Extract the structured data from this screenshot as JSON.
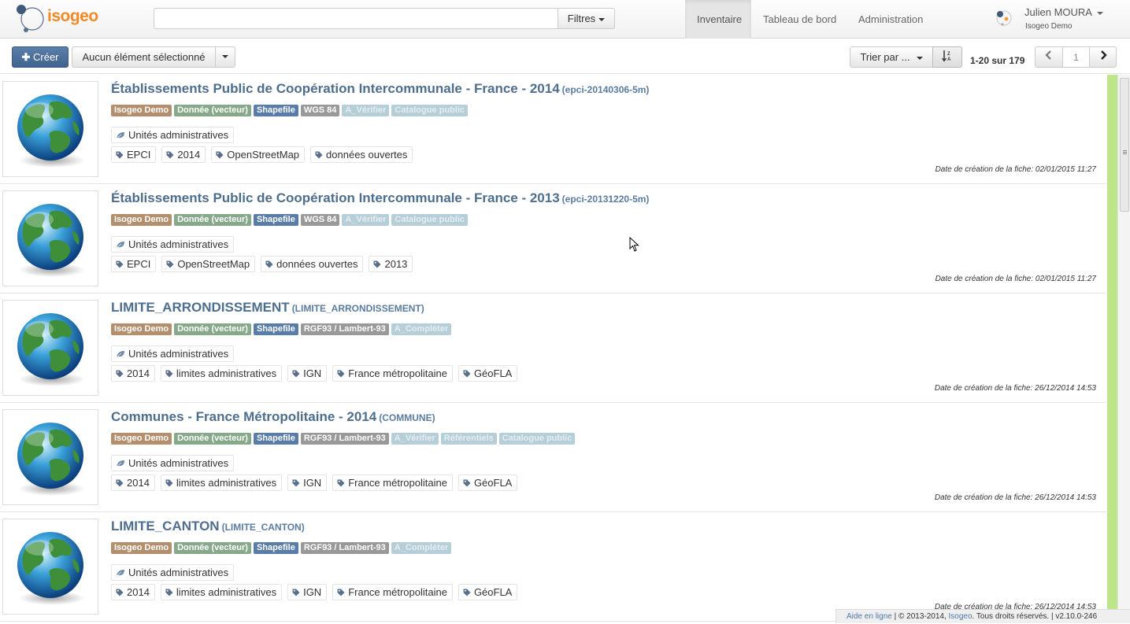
{
  "header": {
    "logo_text": "isogeo",
    "search": {
      "value": "",
      "placeholder": ""
    },
    "filters_label": "Filtres",
    "nav": [
      {
        "label": "Inventaire",
        "active": true
      },
      {
        "label": "Tableau de bord",
        "active": false
      },
      {
        "label": "Administration",
        "active": false
      }
    ],
    "user": {
      "name": "Julien MOURA",
      "org": "Isogeo Demo"
    }
  },
  "toolbar": {
    "create_label": "Créer",
    "selection_label": "Aucun élément sélectionné",
    "sort_label": "Trier par ...",
    "sort_direction_icon": "sort-alpha-icon",
    "range_text": "1-20 sur 179",
    "current_page": "1"
  },
  "items": [
    {
      "title": "Établissements Public de Coopération Intercommunale - France - 2014",
      "code": "(epci-20140306-5m)",
      "labels": [
        {
          "text": "Isogeo Demo",
          "kind": "org"
        },
        {
          "text": "Donnée (vecteur)",
          "kind": "type"
        },
        {
          "text": "Shapefile",
          "kind": "fmt"
        },
        {
          "text": "WGS 84",
          "kind": "srs"
        },
        {
          "text": "A_Vérifier",
          "kind": "faint"
        },
        {
          "text": "Catalogue public",
          "kind": "faint"
        }
      ],
      "theme": "Unités administratives",
      "keywords": [
        "EPCI",
        "2014",
        "OpenStreetMap",
        "données ouvertes"
      ],
      "date": "Date de création de la fiche: 02/01/2015 11:27"
    },
    {
      "title": "Établissements Public de Coopération Intercommunale - France - 2013",
      "code": "(epci-20131220-5m)",
      "labels": [
        {
          "text": "Isogeo Demo",
          "kind": "org"
        },
        {
          "text": "Donnée (vecteur)",
          "kind": "type"
        },
        {
          "text": "Shapefile",
          "kind": "fmt"
        },
        {
          "text": "WGS 84",
          "kind": "srs"
        },
        {
          "text": "A_Vérifier",
          "kind": "faint"
        },
        {
          "text": "Catalogue public",
          "kind": "faint"
        }
      ],
      "theme": "Unités administratives",
      "keywords": [
        "EPCI",
        "OpenStreetMap",
        "données ouvertes",
        "2013"
      ],
      "date": "Date de création de la fiche: 02/01/2015 11:27"
    },
    {
      "title": "LIMITE_ARRONDISSEMENT",
      "code": "(LIMITE_ARRONDISSEMENT)",
      "labels": [
        {
          "text": "Isogeo Demo",
          "kind": "org"
        },
        {
          "text": "Donnée (vecteur)",
          "kind": "type"
        },
        {
          "text": "Shapefile",
          "kind": "fmt"
        },
        {
          "text": "RGF93 / Lambert-93",
          "kind": "srs"
        },
        {
          "text": "A_Compléter",
          "kind": "faint"
        }
      ],
      "theme": "Unités administratives",
      "keywords": [
        "2014",
        "limites administratives",
        "IGN",
        "France métropolitaine",
        "GéoFLA"
      ],
      "date": "Date de création de la fiche: 26/12/2014 14:53"
    },
    {
      "title": "Communes - France Métropolitaine - 2014",
      "code": "(COMMUNE)",
      "labels": [
        {
          "text": "Isogeo Demo",
          "kind": "org"
        },
        {
          "text": "Donnée (vecteur)",
          "kind": "type"
        },
        {
          "text": "Shapefile",
          "kind": "fmt"
        },
        {
          "text": "RGF93 / Lambert-93",
          "kind": "srs"
        },
        {
          "text": "A_Vérifier",
          "kind": "faint"
        },
        {
          "text": "Référentiels",
          "kind": "faint"
        },
        {
          "text": "Catalogue public",
          "kind": "faint"
        }
      ],
      "theme": "Unités administratives",
      "keywords": [
        "2014",
        "limites administratives",
        "IGN",
        "France métropolitaine",
        "GéoFLA"
      ],
      "date": "Date de création de la fiche: 26/12/2014 14:53"
    },
    {
      "title": "LIMITE_CANTON",
      "code": "(LIMITE_CANTON)",
      "labels": [
        {
          "text": "Isogeo Demo",
          "kind": "org"
        },
        {
          "text": "Donnée (vecteur)",
          "kind": "type"
        },
        {
          "text": "Shapefile",
          "kind": "fmt"
        },
        {
          "text": "RGF93 / Lambert-93",
          "kind": "srs"
        },
        {
          "text": "A_Compléter",
          "kind": "faint"
        }
      ],
      "theme": "Unités administratives",
      "keywords": [
        "2014",
        "limites administratives",
        "IGN",
        "France métropolitaine",
        "GéoFLA"
      ],
      "date": "Date de création de la fiche: 26/12/2014 14:53"
    }
  ],
  "footer": {
    "help": "Aide en ligne",
    "copyright": " | © 2013-2014, ",
    "brand": "Isogeo",
    "rights": ". Tous droits réservés. | v2.10.0-246"
  },
  "colors": {
    "accent": "#4e6e8e",
    "create_button": "#4a6c98",
    "logo": "#f08a24",
    "status_strip": "#bde68a"
  }
}
